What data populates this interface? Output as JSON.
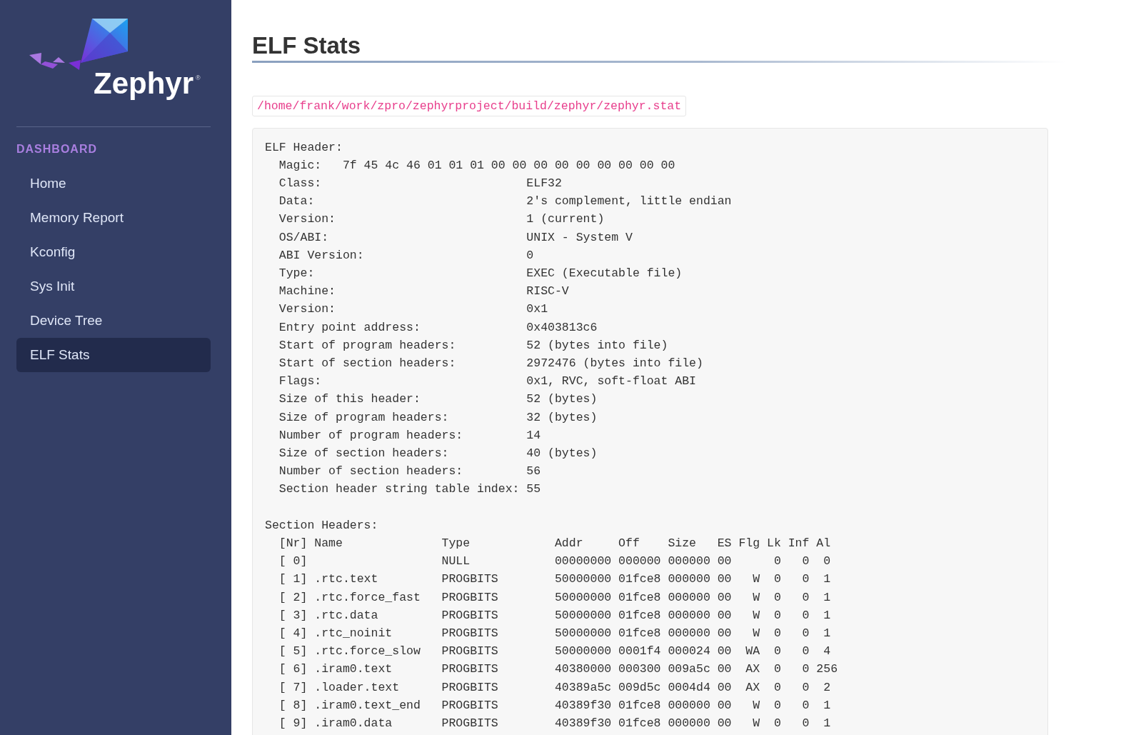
{
  "sidebar": {
    "logo": {
      "text": "Zephyr",
      "mark": "®"
    },
    "section_title": "DASHBOARD",
    "items": [
      {
        "label": "Home",
        "selected": false
      },
      {
        "label": "Memory Report",
        "selected": false
      },
      {
        "label": "Kconfig",
        "selected": false
      },
      {
        "label": "Sys Init",
        "selected": false
      },
      {
        "label": "Device Tree",
        "selected": false
      },
      {
        "label": "ELF Stats",
        "selected": true
      }
    ]
  },
  "main": {
    "title": "ELF Stats",
    "file_path": "/home/frank/work/zpro/zephyrproject/build/zephyr/zephyr.stat",
    "output_blocks": [
      {
        "lines": [
          "ELF Header:",
          "  Magic:   7f 45 4c 46 01 01 01 00 00 00 00 00 00 00 00 00",
          "  Class:                             ELF32",
          "  Data:                              2's complement, little endian",
          "  Version:                           1 (current)",
          "  OS/ABI:                            UNIX - System V",
          "  ABI Version:                       0",
          "  Type:                              EXEC (Executable file)",
          "  Machine:                           RISC-V",
          "  Version:                           0x1",
          "  Entry point address:               0x403813c6",
          "  Start of program headers:          52 (bytes into file)",
          "  Start of section headers:          2972476 (bytes into file)",
          "  Flags:                             0x1, RVC, soft-float ABI",
          "  Size of this header:               52 (bytes)",
          "  Size of program headers:           32 (bytes)",
          "  Number of program headers:         14",
          "  Size of section headers:           40 (bytes)",
          "  Number of section headers:         56",
          "  Section header string table index: 55"
        ]
      },
      {
        "lines": [
          "Section Headers:",
          "  [Nr] Name              Type            Addr     Off    Size   ES Flg Lk Inf Al",
          "  [ 0]                   NULL            00000000 000000 000000 00      0   0  0",
          "  [ 1] .rtc.text         PROGBITS        50000000 01fce8 000000 00   W  0   0  1",
          "  [ 2] .rtc.force_fast   PROGBITS        50000000 01fce8 000000 00   W  0   0  1",
          "  [ 3] .rtc.data         PROGBITS        50000000 01fce8 000000 00   W  0   0  1",
          "  [ 4] .rtc_noinit       PROGBITS        50000000 01fce8 000000 00   W  0   0  1",
          "  [ 5] .rtc.force_slow   PROGBITS        50000000 0001f4 000024 00  WA  0   0  4",
          "  [ 6] .iram0.text       PROGBITS        40380000 000300 009a5c 00  AX  0   0 256",
          "  [ 7] .loader.text      PROGBITS        40389a5c 009d5c 0004d4 00  AX  0   0  2",
          "  [ 8] .iram0.text_end   PROGBITS        40389f30 01fce8 000000 00   W  0   0  1",
          "  [ 9] .iram0.data       PROGBITS        40389f30 01fce8 000000 00   W  0   0  1"
        ]
      }
    ]
  }
}
